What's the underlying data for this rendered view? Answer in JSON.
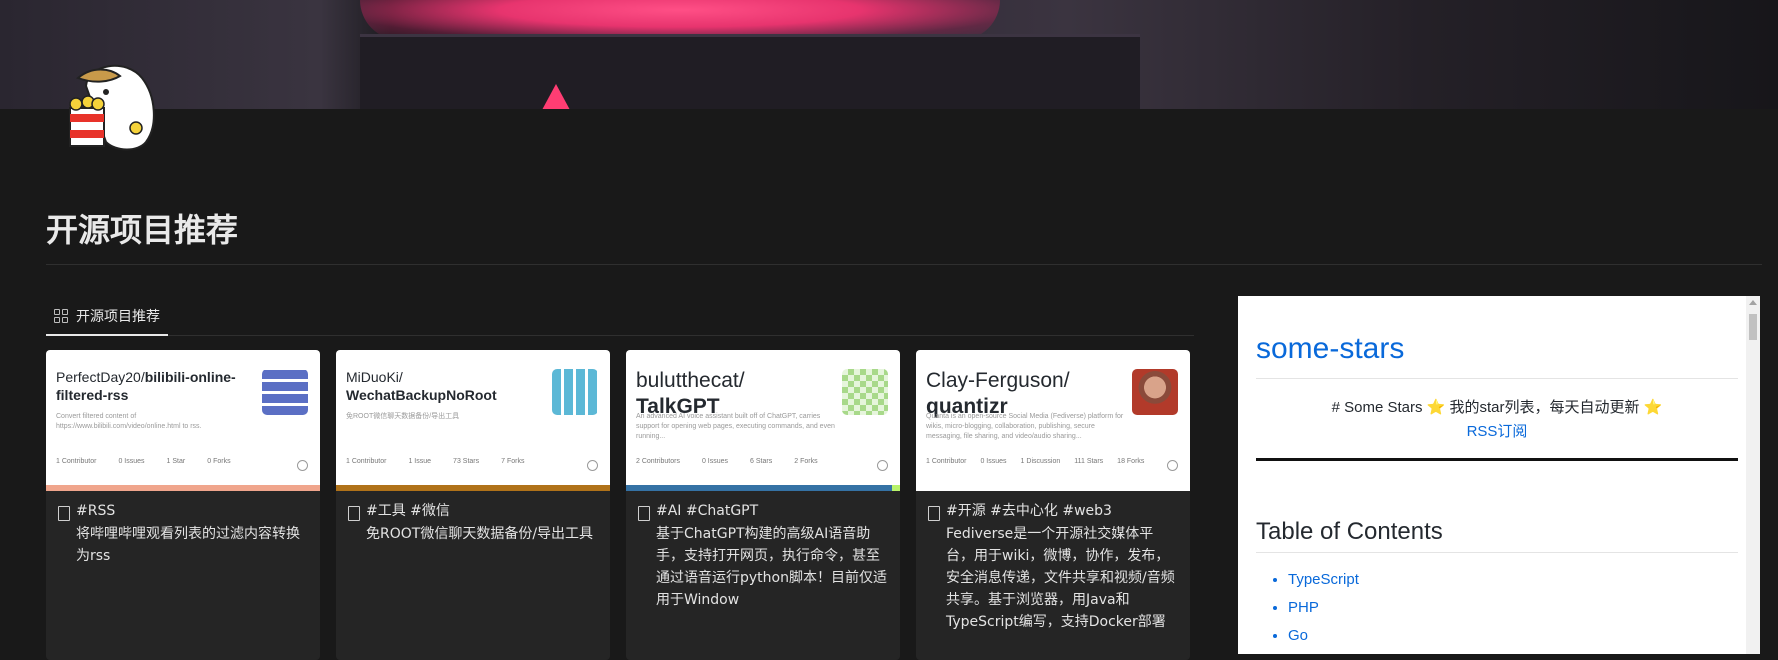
{
  "page": {
    "title": "开源项目推荐",
    "view_tab": "开源项目推荐"
  },
  "cards": [
    {
      "owner": "PerfectDay20/",
      "repo": "bilibili-online-filtered-rss",
      "repo_desc": "Convert filtered content of https://www.bilibili.com/video/online.html to rss.",
      "stats": [
        "1 Contributor",
        "0 Issues",
        "1 Star",
        "0 Forks"
      ],
      "tags": "#RSS",
      "description": "将哔哩哔哩观看列表的过滤内容转换为rss",
      "bar_color": "#f0a58c",
      "icon_color": "#5b6fc4"
    },
    {
      "owner": "MiDuoKi/",
      "repo": "WechatBackupNoRoot",
      "repo_desc": "免ROOT微信聊天数据备份/导出工具",
      "stats": [
        "1 Contributor",
        "1 Issue",
        "73 Stars",
        "7 Forks"
      ],
      "tags": "#工具 #微信",
      "description": "免ROOT微信聊天数据备份/导出工具",
      "bar_color": "#b07219",
      "icon_color": "#5cb8d6"
    },
    {
      "owner": "bulutthecat/",
      "repo": "TalkGPT",
      "repo_desc": "An advanced AI voice assistant built off of ChatGPT, carries support for opening web pages, executing commands, and even running...",
      "stats": [
        "2 Contributors",
        "0 Issues",
        "6 Stars",
        "2 Forks"
      ],
      "tags": "#AI #ChatGPT",
      "description": "基于ChatGPT构建的高级AI语音助手，支持打开网页，执行命令，甚至通过语音运行python脚本！目前仅适用于Window",
      "bar_color": "#3572a5",
      "icon_color": "#a8d98a"
    },
    {
      "owner": "Clay-Ferguson/",
      "repo": "quantizr",
      "repo_desc": "Quanta is an open-source Social Media (Fediverse) platform for wikis, micro-blogging, collaboration, publishing, secure messaging, file sharing, and video/audio sharing...",
      "stats": [
        "1 Contributor",
        "0 Issues",
        "1 Discussion",
        "111 Stars",
        "18 Forks"
      ],
      "tags": "#开源 #去中心化 #web3",
      "description": "Fediverse是一个开源社交媒体平台，用于wiki，微博，协作，发布，安全消息传递，文件共享和视频/音频共享。基于浏览器，用Java和TypeScript编写，支持Docker部署",
      "bar_color": "#3178c6",
      "icon_color": "#b26a4f"
    }
  ],
  "embed": {
    "heading": "some-stars",
    "intro": "# Some Stars ⭐ 我的star列表，每天自动更新 ⭐",
    "rss_link": "RSS订阅",
    "toc_heading": "Table of Contents",
    "toc": [
      "TypeScript",
      "PHP",
      "Go"
    ]
  }
}
